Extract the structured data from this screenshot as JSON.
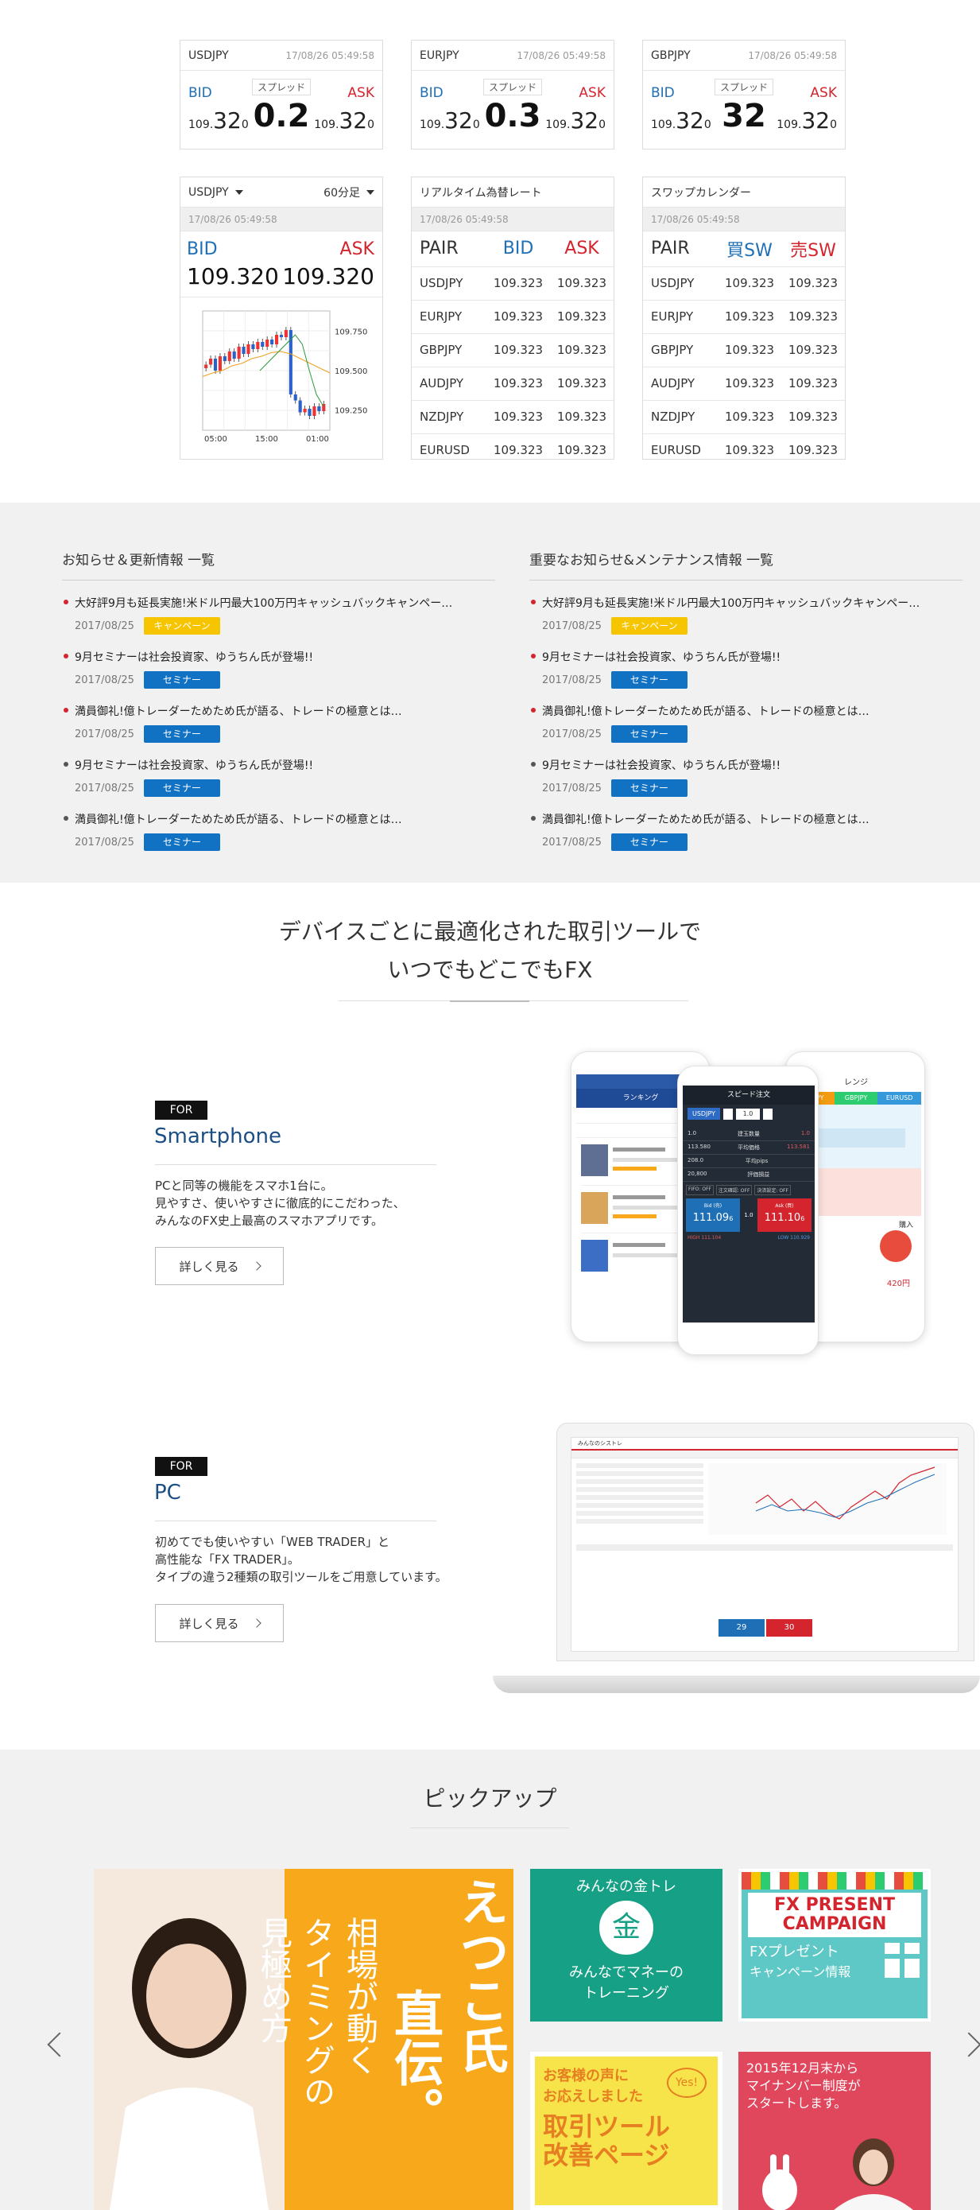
{
  "quotes": [
    {
      "pair": "USDJPY",
      "time": "17/08/26  05:49:58",
      "bid_label": "BID",
      "ask_label": "ASK",
      "spread_label": "スプレッド",
      "spread": "0.2",
      "bid_pre": "109.",
      "bid_big": "32",
      "bid_post": "0",
      "ask_pre": "109.",
      "ask_big": "32",
      "ask_post": "0"
    },
    {
      "pair": "EURJPY",
      "time": "17/08/26  05:49:58",
      "bid_label": "BID",
      "ask_label": "ASK",
      "spread_label": "スプレッド",
      "spread": "0.3",
      "bid_pre": "109.",
      "bid_big": "32",
      "bid_post": "0",
      "ask_pre": "109.",
      "ask_big": "32",
      "ask_post": "0"
    },
    {
      "pair": "GBPJPY",
      "time": "17/08/26  05:49:58",
      "bid_label": "BID",
      "ask_label": "ASK",
      "spread_label": "スプレッド",
      "spread": "32",
      "bid_pre": "109.",
      "bid_big": "32",
      "bid_post": "0",
      "ask_pre": "109.",
      "ask_big": "32",
      "ask_post": "0"
    }
  ],
  "chart_widget": {
    "pair": "USDJPY",
    "interval": "60分足",
    "time": "17/08/26  05:49:58",
    "bid_label": "BID",
    "ask_label": "ASK",
    "bid": "109.320",
    "ask": "109.320",
    "chart_data": {
      "type": "candlestick",
      "yticks": [
        "109.750",
        "109.500",
        "109.250"
      ],
      "xticks": [
        "05:00",
        "15:00",
        "01:00"
      ]
    }
  },
  "rate_table": {
    "title": "リアルタイム為替レート",
    "time": "17/08/26  05:49:58",
    "headers": [
      "PAIR",
      "BID",
      "ASK"
    ],
    "rows": [
      [
        "USDJPY",
        "109.323",
        "109.323"
      ],
      [
        "EURJPY",
        "109.323",
        "109.323"
      ],
      [
        "GBPJPY",
        "109.323",
        "109.323"
      ],
      [
        "AUDJPY",
        "109.323",
        "109.323"
      ],
      [
        "NZDJPY",
        "109.323",
        "109.323"
      ],
      [
        "EURUSD",
        "109.323",
        "109.323"
      ]
    ]
  },
  "swap_table": {
    "title": "スワップカレンダー",
    "time": "17/08/26  05:49:58",
    "headers": [
      "PAIR",
      "買SW",
      "売SW"
    ],
    "rows": [
      [
        "USDJPY",
        "109.323",
        "109.323"
      ],
      [
        "EURJPY",
        "109.323",
        "109.323"
      ],
      [
        "GBPJPY",
        "109.323",
        "109.323"
      ],
      [
        "AUDJPY",
        "109.323",
        "109.323"
      ],
      [
        "NZDJPY",
        "109.323",
        "109.323"
      ],
      [
        "EURUSD",
        "109.323",
        "109.323"
      ]
    ]
  },
  "news_left": {
    "title": "お知らせ＆更新情報 一覧",
    "items": [
      {
        "text": "大好評9月も延長実施!米ドル円最大100万円キャッシュバックキャンペー…",
        "date": "2017/08/25",
        "tag": "キャンペーン",
        "tag_color": "yellow",
        "new": true
      },
      {
        "text": "9月セミナーは社会投資家、ゆうちん氏が登場!!",
        "date": "2017/08/25",
        "tag": "セミナー",
        "tag_color": "blue",
        "new": true
      },
      {
        "text": "満員御礼!億トレーダーためため氏が語る、トレードの極意とは…",
        "date": "2017/08/25",
        "tag": "セミナー",
        "tag_color": "blue",
        "new": true
      },
      {
        "text": "9月セミナーは社会投資家、ゆうちん氏が登場!!",
        "date": "2017/08/25",
        "tag": "セミナー",
        "tag_color": "blue",
        "new": false
      },
      {
        "text": "満員御礼!億トレーダーためため氏が語る、トレードの極意とは…",
        "date": "2017/08/25",
        "tag": "セミナー",
        "tag_color": "blue",
        "new": false
      }
    ]
  },
  "news_right": {
    "title": "重要なお知らせ&メンテナンス情報 一覧",
    "items": [
      {
        "text": "大好評9月も延長実施!米ドル円最大100万円キャッシュバックキャンペー…",
        "date": "2017/08/25",
        "tag": "キャンペーン",
        "tag_color": "yellow",
        "new": true
      },
      {
        "text": "9月セミナーは社会投資家、ゆうちん氏が登場!!",
        "date": "2017/08/25",
        "tag": "セミナー",
        "tag_color": "blue",
        "new": true
      },
      {
        "text": "満員御礼!億トレーダーためため氏が語る、トレードの極意とは…",
        "date": "2017/08/25",
        "tag": "セミナー",
        "tag_color": "blue",
        "new": true
      },
      {
        "text": "9月セミナーは社会投資家、ゆうちん氏が登場!!",
        "date": "2017/08/25",
        "tag": "セミナー",
        "tag_color": "blue",
        "new": false
      },
      {
        "text": "満員御礼!億トレーダーためため氏が語る、トレードの極意とは…",
        "date": "2017/08/25",
        "tag": "セミナー",
        "tag_color": "blue",
        "new": false
      }
    ]
  },
  "tools": {
    "headline_1": "デバイスごとに最適化された取引ツールで",
    "headline_2": "いつでもどこでもFX",
    "smartphone": {
      "for": "FOR",
      "name": "Smartphone",
      "desc_1": "PCと同等の機能をスマホ1台に。",
      "desc_2": "見やすさ、使いやすさに徹底的にこだわった、",
      "desc_3": "みんなのFX史上最高のスマホアプリです。",
      "button": "詳しく見る"
    },
    "pc": {
      "for": "FOR",
      "name": "PC",
      "desc_1": "初めてでも使いやすい「WEB TRADER」と",
      "desc_2": "高性能な「FX TRADER」。",
      "desc_3": "タイプの違う2種類の取引ツールをご用意しています。",
      "button": "詳しく見る"
    },
    "phone_left": {
      "title": "ランキング"
    },
    "phone_mid": {
      "title": "スピード注文",
      "pair": "USDJPY",
      "qty": "1.0",
      "bid_label": "Bid (売)",
      "ask_label": "Ask (買)",
      "bid": "111.09",
      "bid_small": "6",
      "ask": "111.10",
      "ask_small": "6",
      "spread": "1.0",
      "rows": [
        [
          "1.0",
          "建玉数量",
          "1.0"
        ],
        [
          "113.580",
          "平均価格",
          "113.581"
        ],
        [
          "208.0",
          "平均pips",
          ""
        ],
        [
          "20,800",
          "評価損益",
          ""
        ]
      ],
      "opts": [
        "FIFO: OFF",
        "注文確認: OFF",
        "決済設定: OFF"
      ],
      "high": "HIGH 111.104",
      "low": "LOW 110.929"
    },
    "phone_right": {
      "title": "レンジ",
      "tabs": [
        "EURJPY",
        "GBPJPY",
        "EURUSD"
      ],
      "buy": "購入",
      "amount": "420円"
    },
    "laptop": {
      "logo": "みんなのシストレ",
      "sell_val": "29",
      "buy_val": "30"
    }
  },
  "pickup": {
    "title": "ピックアップ",
    "banner_main_1": "えつこ氏",
    "banner_main_2": "直伝。",
    "banner_main_3": "相場が動く",
    "banner_main_4": "タイミングの",
    "banner_main_5": "見極め方",
    "banner_kin_1": "みんなの金トレ",
    "banner_kin_2": "金",
    "banner_kin_3": "みんなでマネーの",
    "banner_kin_4": "トレーニング",
    "banner_fx_1": "FX PRESENT",
    "banner_fx_2": "CAMPAIGN",
    "banner_fx_3": "FXプレゼント",
    "banner_fx_4": "キャンペーン情報",
    "banner_voice_1": "お客様の声に",
    "banner_voice_2": "お応えしました",
    "banner_voice_3": "Yes!",
    "banner_voice_4": "取引ツール",
    "banner_voice_5": "改善ページ",
    "banner_mynum_1": "2015年12月末から",
    "banner_mynum_2": "マイナンバー制度が",
    "banner_mynum_3": "スタートします。"
  },
  "colors": {
    "bid": "#1f6fb7",
    "ask": "#d4242d",
    "pc_blue": "#1c4f86",
    "tag_yellow": "#f7c400",
    "tag_blue": "#1171c2",
    "main_banner": "#f7a81b",
    "kin_green": "#16a085",
    "fx_teal": "#5ec8c6",
    "mynumber": "#e0465c"
  }
}
